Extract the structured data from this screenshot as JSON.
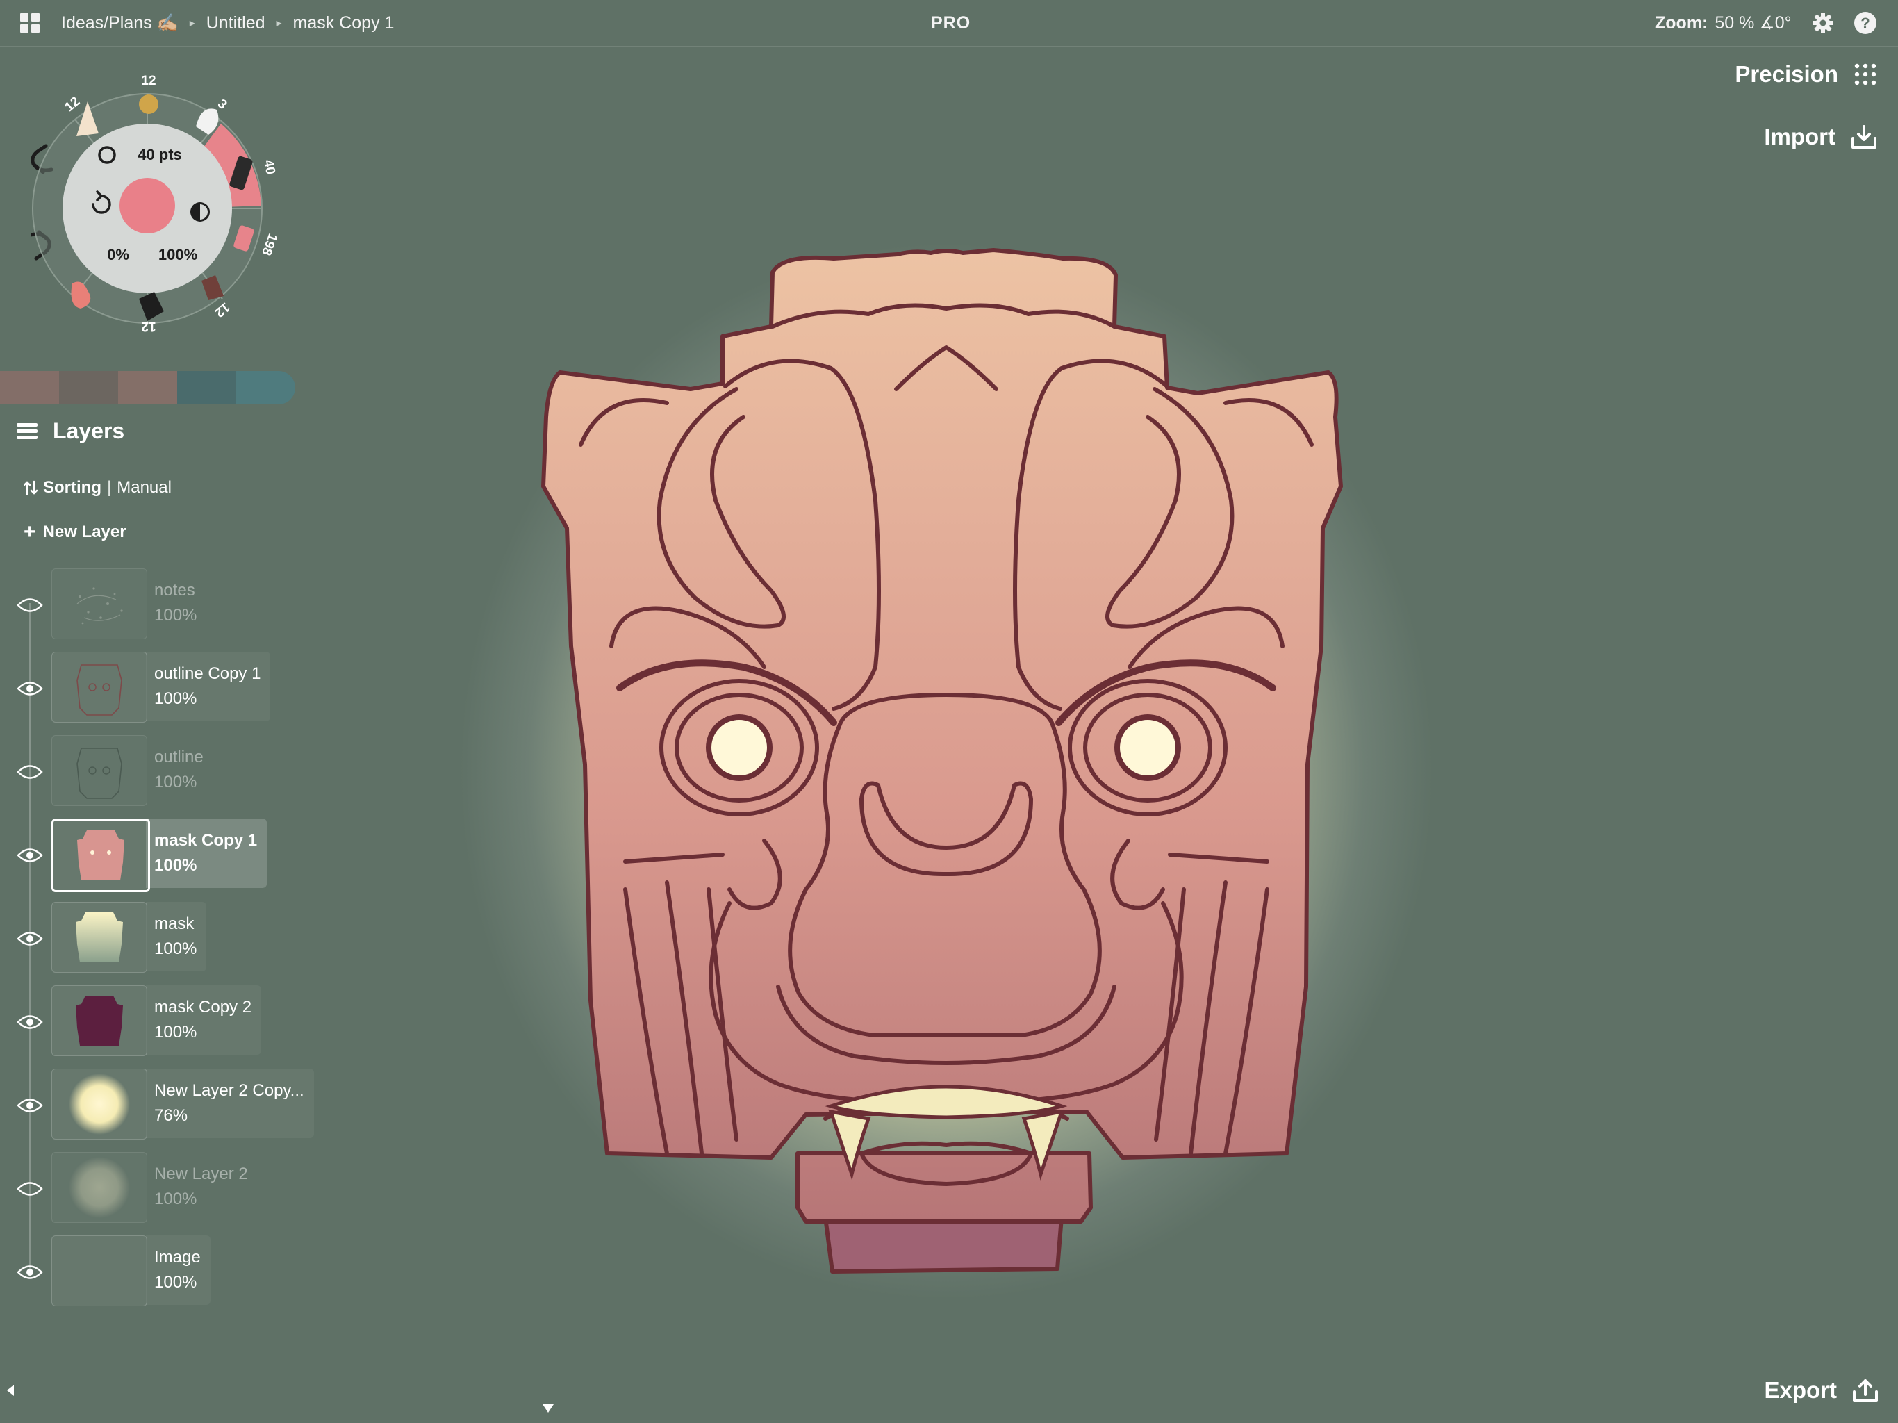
{
  "breadcrumb": [
    "Ideas/Plans ✍🏼",
    "Untitled",
    "mask Copy 1"
  ],
  "topbar": {
    "pro": "PRO",
    "zoom_label": "Zoom:",
    "zoom_value": "50 % ∡0°"
  },
  "right_tools": {
    "precision": "Precision",
    "import": "Import",
    "export": "Export"
  },
  "brush": {
    "size": "40 pts",
    "smoothing": "0%",
    "opacity": "100%",
    "color": "#e98089",
    "presets": [
      "12",
      "12",
      "3",
      "40",
      "198",
      "12",
      "12"
    ]
  },
  "palette": [
    "#836e68",
    "#6c6660",
    "#846f68",
    "#4a6b6c",
    "#4f7b7e"
  ],
  "layers_panel": {
    "title": "Layers",
    "sorting_label": "Sorting",
    "sorting_value": "Manual",
    "new_layer": "New Layer",
    "layers": [
      {
        "name": "notes",
        "opacity": "100%",
        "visible": false,
        "selected": false,
        "thumb": "notes"
      },
      {
        "name": "outline Copy 1",
        "opacity": "100%",
        "visible": true,
        "selected": false,
        "thumb": "outline-red"
      },
      {
        "name": "outline",
        "opacity": "100%",
        "visible": false,
        "selected": false,
        "thumb": "outline-dark"
      },
      {
        "name": "mask Copy 1",
        "opacity": "100%",
        "visible": true,
        "selected": true,
        "thumb": "mask-pink"
      },
      {
        "name": "mask",
        "opacity": "100%",
        "visible": true,
        "selected": false,
        "thumb": "mask-yellow"
      },
      {
        "name": "mask Copy 2",
        "opacity": "100%",
        "visible": true,
        "selected": false,
        "thumb": "mask-purple"
      },
      {
        "name": "New Layer 2 Copy...",
        "opacity": "76%",
        "visible": true,
        "selected": false,
        "thumb": "glow-yellow"
      },
      {
        "name": "New Layer 2",
        "opacity": "100%",
        "visible": false,
        "selected": false,
        "thumb": "glow-grey"
      },
      {
        "name": "Image",
        "opacity": "100%",
        "visible": true,
        "selected": false,
        "thumb": "empty"
      }
    ]
  },
  "colors": {
    "outline": "#6b2e35",
    "mask_top": "#edc3a4",
    "mask_bottom": "#b77173",
    "jaw": "#9f6273"
  }
}
